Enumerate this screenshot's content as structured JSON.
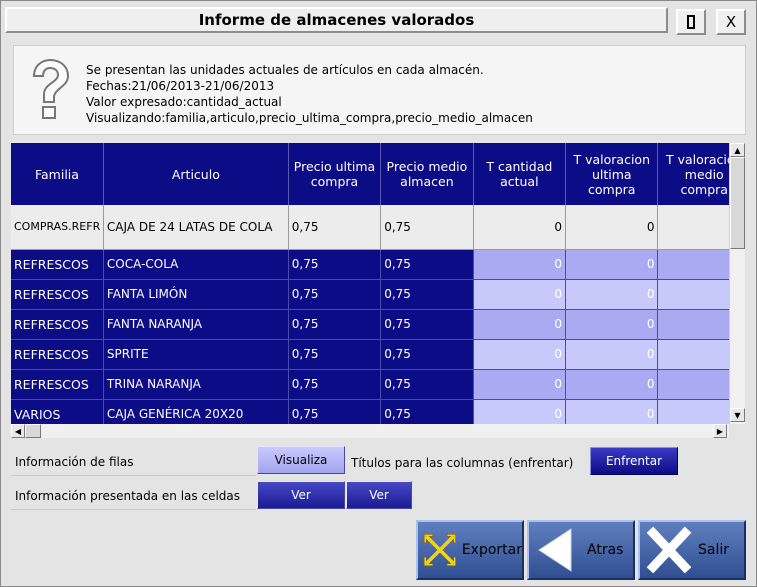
{
  "window": {
    "title": "Informe de almacenes valorados",
    "max_label": "",
    "close_label": "X"
  },
  "info": {
    "lines": [
      "Se presentan las unidades actuales de artículos en cada almacén.",
      "Fechas:21/06/2013-21/06/2013",
      "Valor expresado:cantidad_actual",
      "Visualizando:familia,articulo,precio_ultima_compra,precio_medio_almacen"
    ]
  },
  "table": {
    "columns": [
      "Familia",
      "Articulo",
      "Precio ultima compra",
      "Precio medio almacen",
      "T cantidad actual",
      "T valoracion ultima compra",
      "T valoracion medio compra"
    ],
    "rows": [
      [
        "COMPRAS.REFR",
        "CAJA DE 24 LATAS DE COLA",
        "0,75",
        "0,75",
        "0",
        "0",
        "0"
      ],
      [
        "REFRESCOS",
        "COCA-COLA",
        "0,75",
        "0,75",
        "0",
        "0",
        "0"
      ],
      [
        "REFRESCOS",
        "FANTA LIMÓN",
        "0,75",
        "0,75",
        "0",
        "0",
        "0"
      ],
      [
        "REFRESCOS",
        "FANTA NARANJA",
        "0,75",
        "0,75",
        "0",
        "0",
        "0"
      ],
      [
        "REFRESCOS",
        "SPRITE",
        "0,75",
        "0,75",
        "0",
        "0",
        "0"
      ],
      [
        "REFRESCOS",
        "TRINA NARANJA",
        "0,75",
        "0,75",
        "0",
        "0",
        "0"
      ],
      [
        "VARIOS",
        "CAJA GENÉRICA 20X20",
        "0,75",
        "0,75",
        "0",
        "0",
        "0"
      ]
    ]
  },
  "options": {
    "row_info_label": "Información de filas",
    "visualize_button": "Visualiza",
    "column_titles_label": "Títulos para las columnas (enfrentar)",
    "face_button": "Enfrentar",
    "cell_info_label": "Información presentada en las celdas",
    "view_button_1": "Ver",
    "view_button_2": "Ver"
  },
  "actions": {
    "export": "Exportar",
    "back": "Atras",
    "exit": "Salir"
  },
  "colors": {
    "header_bg": "#0c0c86",
    "row_highlight_a": "#a9aaf2",
    "row_highlight_b": "#c8c9fb",
    "button_blue": "#2f4f92"
  }
}
